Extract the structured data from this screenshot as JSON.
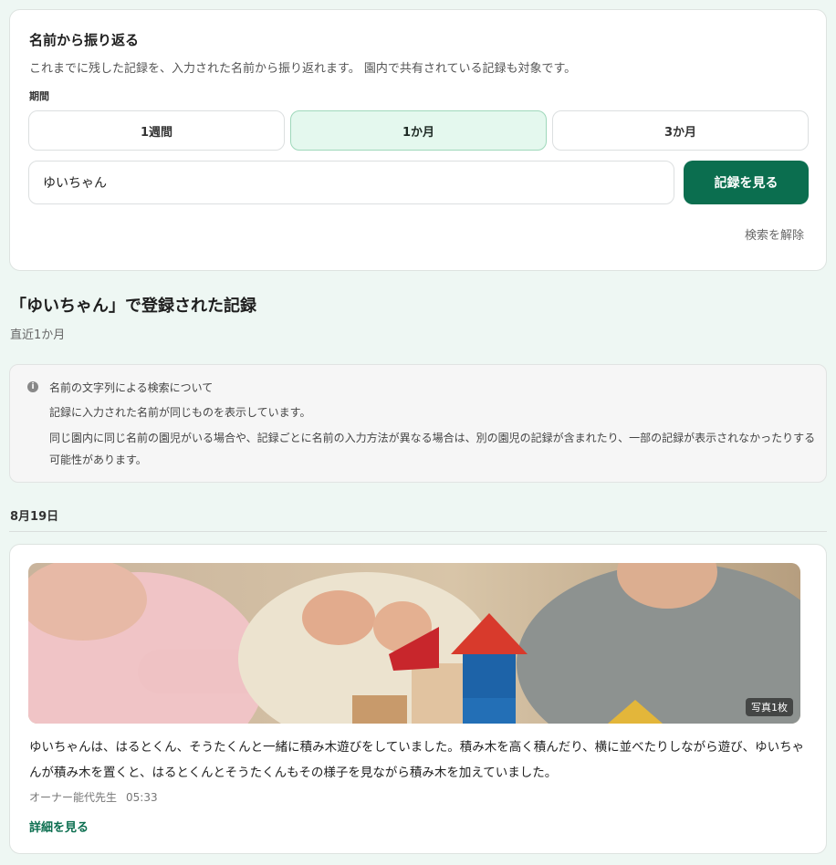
{
  "search": {
    "title": "名前から振り返る",
    "description": "これまでに残した記録を、入力された名前から振り返れます。 園内で共有されている記録も対象です。",
    "period_label": "期間",
    "periods": [
      {
        "label": "1週間",
        "selected": false
      },
      {
        "label": "1か月",
        "selected": true
      },
      {
        "label": "3か月",
        "selected": false
      }
    ],
    "name_value": "ゆいちゃん",
    "view_button": "記録を見る",
    "clear_link": "検索を解除"
  },
  "results": {
    "title": "「ゆいちゃん」で登録された記録",
    "range": "直近1か月"
  },
  "notice": {
    "icon": "info-icon",
    "title": "名前の文字列による検索について",
    "line1": "記録に入力された名前が同じものを表示しています。",
    "line2": "同じ園内に同じ名前の園児がいる場合や、記録ごとに名前の入力方法が異なる場合は、別の園児の記録が含まれたり、一部の記録が表示されなかったりする可能性があります。"
  },
  "records": [
    {
      "date": "8月19日",
      "photo_count": "写真1枚",
      "text": "ゆいちゃんは、はるとくん、そうたくんと一緒に積み木遊びをしていました。積み木を高く積んだり、横に並べたりしながら遊び、ゆいちゃんが積み木を置くと、はるとくんとそうたくんもその様子を見ながら積み木を加えていました。",
      "author": "オーナー能代先生",
      "time": "05:33",
      "detail_link": "詳細を見る"
    }
  ],
  "colors": {
    "accent": "#0b6e4f",
    "selected_bg": "#e4f8ee",
    "page_bg": "#eef7f3"
  }
}
